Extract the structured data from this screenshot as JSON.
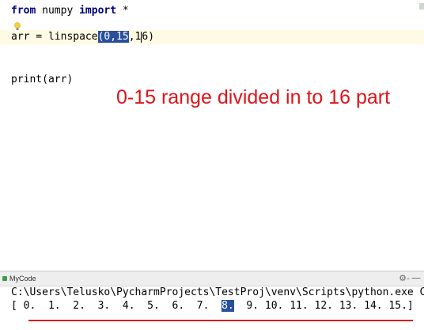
{
  "editor": {
    "line1": {
      "kw1": "from",
      "mod": " numpy ",
      "kw2": "import",
      "rest": " *"
    },
    "line3": {
      "pre": "arr = linspace",
      "selected": "(0,15",
      "mid": ",1",
      "post": "6)"
    },
    "line5": "print(arr)"
  },
  "annotation": "0-15 range divided in to 16 part",
  "panel": {
    "tab_label": "MyCode",
    "gear_icon": "⚙-",
    "minimize_icon": "—"
  },
  "console": {
    "path_line": "C:\\Users\\Telusko\\PycharmProjects\\TestProj\\venv\\Scripts\\python.exe C",
    "output_pre": "[ 0.  1.  2.  3.  4.  5.  6.  7.  ",
    "output_hl": "8.",
    "output_post": "  9. 10. 11. 12. 13. 14. 15.]"
  },
  "colors": {
    "annotation": "#e0141b",
    "selection": "#2a4f9e",
    "keyword": "#000080"
  }
}
